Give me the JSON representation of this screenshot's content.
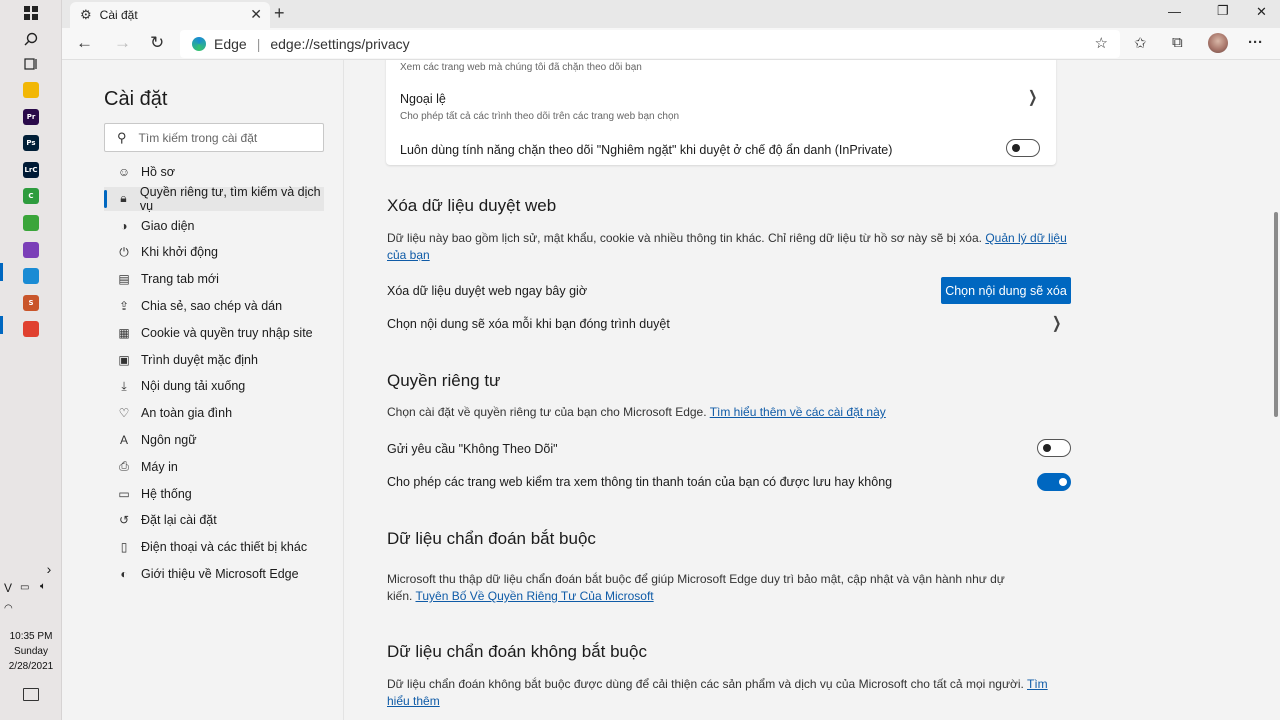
{
  "browser": {
    "tab_title": "Cài đặt",
    "address_brand": "Edge",
    "address_url": "edge://settings/privacy"
  },
  "sidebar": {
    "title": "Cài đặt",
    "search_placeholder": "Tìm kiếm trong cài đặt",
    "items": [
      {
        "label": "Hồ sơ",
        "icon": "profile-icon"
      },
      {
        "label": "Quyền riêng tư, tìm kiếm và dịch vụ",
        "icon": "lock-icon"
      },
      {
        "label": "Giao diện",
        "icon": "appearance-icon"
      },
      {
        "label": "Khi khởi động",
        "icon": "power-icon"
      },
      {
        "label": "Trang tab mới",
        "icon": "new-tab-icon"
      },
      {
        "label": "Chia sẻ, sao chép và dán",
        "icon": "share-icon"
      },
      {
        "label": "Cookie và quyền truy nhập site",
        "icon": "cookie-icon"
      },
      {
        "label": "Trình duyệt mặc định",
        "icon": "browser-icon"
      },
      {
        "label": "Nội dung tải xuống",
        "icon": "download-icon"
      },
      {
        "label": "An toàn gia đình",
        "icon": "family-icon"
      },
      {
        "label": "Ngôn ngữ",
        "icon": "language-icon"
      },
      {
        "label": "Máy in",
        "icon": "printer-icon"
      },
      {
        "label": "Hệ thống",
        "icon": "system-icon"
      },
      {
        "label": "Đặt lại cài đặt",
        "icon": "reset-icon"
      },
      {
        "label": "Điện thoại và các thiết bị khác",
        "icon": "phone-icon"
      },
      {
        "label": "Giới thiệu về Microsoft Edge",
        "icon": "edge-icon"
      }
    ]
  },
  "tracking_card": {
    "blocked_sub": "Xem các trang web mà chúng tôi đã chặn theo dõi bạn",
    "exceptions_label": "Ngoại lệ",
    "exceptions_sub": "Cho phép tất cả các trình theo dõi trên các trang web bạn chọn",
    "strict_inprivate_label": "Luôn dùng tính năng chặn theo dõi \"Nghiêm ngặt\" khi duyệt ở chế độ ẩn danh (InPrivate)",
    "strict_inprivate_on": false
  },
  "clear_data": {
    "heading": "Xóa dữ liệu duyệt web",
    "desc": "Dữ liệu này bao gồm lịch sử, mật khẩu, cookie và nhiều thông tin khác. Chỉ riêng dữ liệu từ hồ sơ này sẽ bị xóa.",
    "desc_link": "Quản lý dữ liệu của bạn",
    "clear_now_label": "Xóa dữ liệu duyệt web ngay bây giờ",
    "clear_now_button": "Chọn nội dung sẽ xóa",
    "on_close_label": "Chọn nội dung sẽ xóa mỗi khi bạn đóng trình duyệt"
  },
  "privacy": {
    "heading": "Quyền riêng tư",
    "desc": "Chọn cài đặt về quyền riêng tư của bạn cho Microsoft Edge.",
    "desc_link": "Tìm hiểu thêm về các cài đặt này",
    "dnt_label": "Gửi yêu cầu \"Không Theo Dõi\"",
    "dnt_on": false,
    "payment_label": "Cho phép các trang web kiểm tra xem thông tin thanh toán của bạn có được lưu hay không",
    "payment_on": true
  },
  "required_diag": {
    "heading": "Dữ liệu chẩn đoán bắt buộc",
    "desc": "Microsoft thu thập dữ liệu chẩn đoán bắt buộc để giúp Microsoft Edge duy trì bảo mật, cập nhật và vận hành như dự kiến.",
    "desc_link": "Tuyên Bố Về Quyền Riêng Tư Của Microsoft"
  },
  "optional_diag": {
    "heading": "Dữ liệu chẩn đoán không bắt buộc",
    "desc": "Dữ liệu chẩn đoán không bắt buộc được dùng để cải thiện các sản phẩm và dịch vụ của Microsoft cho tất cả mọi người.",
    "desc_link": "Tìm hiểu thêm"
  },
  "taskbar": {
    "apps": [
      {
        "icon": "file-explorer-icon",
        "color": "#f2b705",
        "text": ""
      },
      {
        "icon": "premiere-icon",
        "color": "#2a0a4a",
        "text": "Pr"
      },
      {
        "icon": "photoshop-icon",
        "color": "#001e36",
        "text": "Ps"
      },
      {
        "icon": "lightroom-icon",
        "color": "#001a35",
        "text": "LrC"
      },
      {
        "icon": "camtasia-icon",
        "color": "#2e9c3e",
        "text": "C"
      },
      {
        "icon": "app-icon",
        "color": "#3aa53a",
        "text": ""
      },
      {
        "icon": "visual-studio-icon",
        "color": "#7b3fb8",
        "text": ""
      },
      {
        "icon": "edge-taskbar-icon",
        "color": "#1a8bd4",
        "text": ""
      },
      {
        "icon": "app-s-icon",
        "color": "#c9552a",
        "text": "S"
      },
      {
        "icon": "chrome-icon",
        "color": "#e0402f",
        "text": ""
      }
    ],
    "time": "10:35 PM",
    "day": "Sunday",
    "date": "2/28/2021",
    "lang": "V"
  }
}
